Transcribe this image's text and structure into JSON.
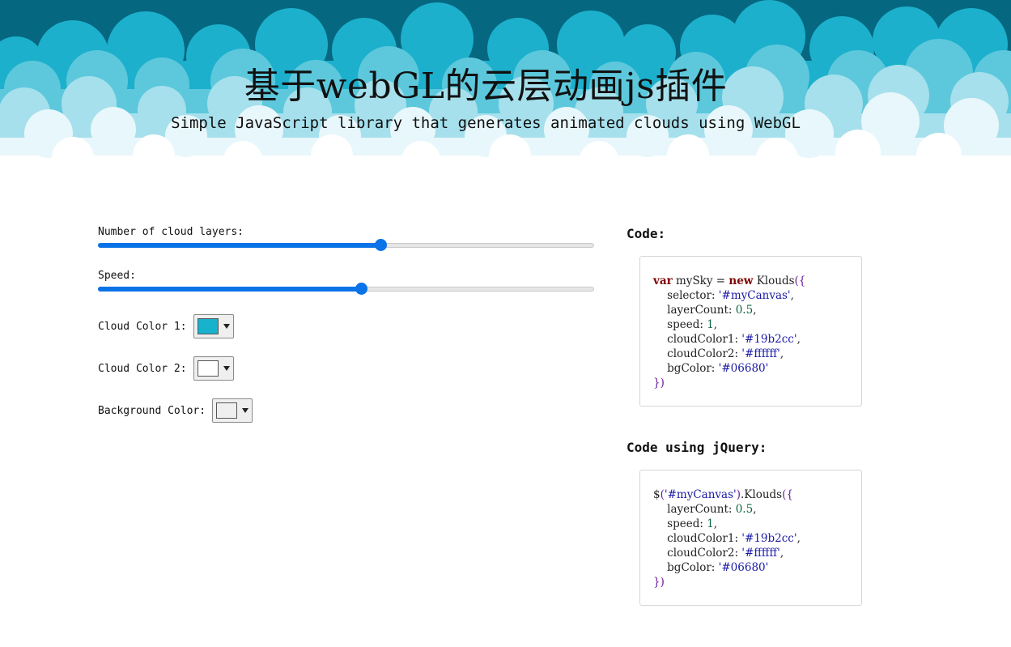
{
  "header": {
    "title": "基于webGL的云层动画js插件",
    "subtitle": "Simple JavaScript library that generates animated clouds using WebGL"
  },
  "controls": {
    "layers": {
      "label": "Number of cloud layers:",
      "value": 0.57
    },
    "speed": {
      "label": "Speed:",
      "value": 0.53
    },
    "colors": [
      {
        "label": "Cloud Color 1:",
        "value": "#19b2cc"
      },
      {
        "label": "Cloud Color 2:",
        "value": "#ffffff"
      },
      {
        "label": "Background Color:",
        "value": "#06680"
      }
    ]
  },
  "code": {
    "heading": "Code:",
    "lines": [
      [
        [
          "k",
          "var"
        ],
        [
          "t",
          " mySky = "
        ],
        [
          "k",
          "new"
        ],
        [
          "t",
          " Klouds"
        ],
        [
          "p",
          "({"
        ]
      ],
      [
        [
          "t",
          "    selector: "
        ],
        [
          "s",
          "'#myCanvas'"
        ],
        [
          "t",
          ","
        ]
      ],
      [
        [
          "t",
          "    layerCount: "
        ],
        [
          "n",
          "0.5"
        ],
        [
          "t",
          ","
        ]
      ],
      [
        [
          "t",
          "    speed: "
        ],
        [
          "n",
          "1"
        ],
        [
          "t",
          ","
        ]
      ],
      [
        [
          "t",
          "    cloudColor1: "
        ],
        [
          "s",
          "'#19b2cc'"
        ],
        [
          "t",
          ","
        ]
      ],
      [
        [
          "t",
          "    cloudColor2: "
        ],
        [
          "s",
          "'#ffffff'"
        ],
        [
          "t",
          ","
        ]
      ],
      [
        [
          "t",
          "    bgColor: "
        ],
        [
          "s",
          "'#06680'"
        ]
      ],
      [
        [
          "p",
          "})"
        ]
      ]
    ]
  },
  "jquery_code": {
    "heading": "Code using jQuery:",
    "lines": [
      [
        [
          "t",
          "$"
        ],
        [
          "p",
          "("
        ],
        [
          "s",
          "'#myCanvas'"
        ],
        [
          "p",
          ")"
        ],
        [
          "t",
          ".Klouds"
        ],
        [
          "p",
          "({"
        ]
      ],
      [
        [
          "t",
          "    layerCount: "
        ],
        [
          "n",
          "0.5"
        ],
        [
          "t",
          ","
        ]
      ],
      [
        [
          "t",
          "    speed: "
        ],
        [
          "n",
          "1"
        ],
        [
          "t",
          ","
        ]
      ],
      [
        [
          "t",
          "    cloudColor1: "
        ],
        [
          "s",
          "'#19b2cc'"
        ],
        [
          "t",
          ","
        ]
      ],
      [
        [
          "t",
          "    cloudColor2: "
        ],
        [
          "s",
          "'#ffffff'"
        ],
        [
          "t",
          ","
        ]
      ],
      [
        [
          "t",
          "    bgColor: "
        ],
        [
          "s",
          "'#06680'"
        ]
      ],
      [
        [
          "p",
          "})"
        ]
      ]
    ]
  },
  "theme": {
    "sky_background": "#066780",
    "cloud_color_1": "#19b2cc",
    "cloud_color_2": "#ffffff",
    "slider_accent": "#0a73e8"
  }
}
